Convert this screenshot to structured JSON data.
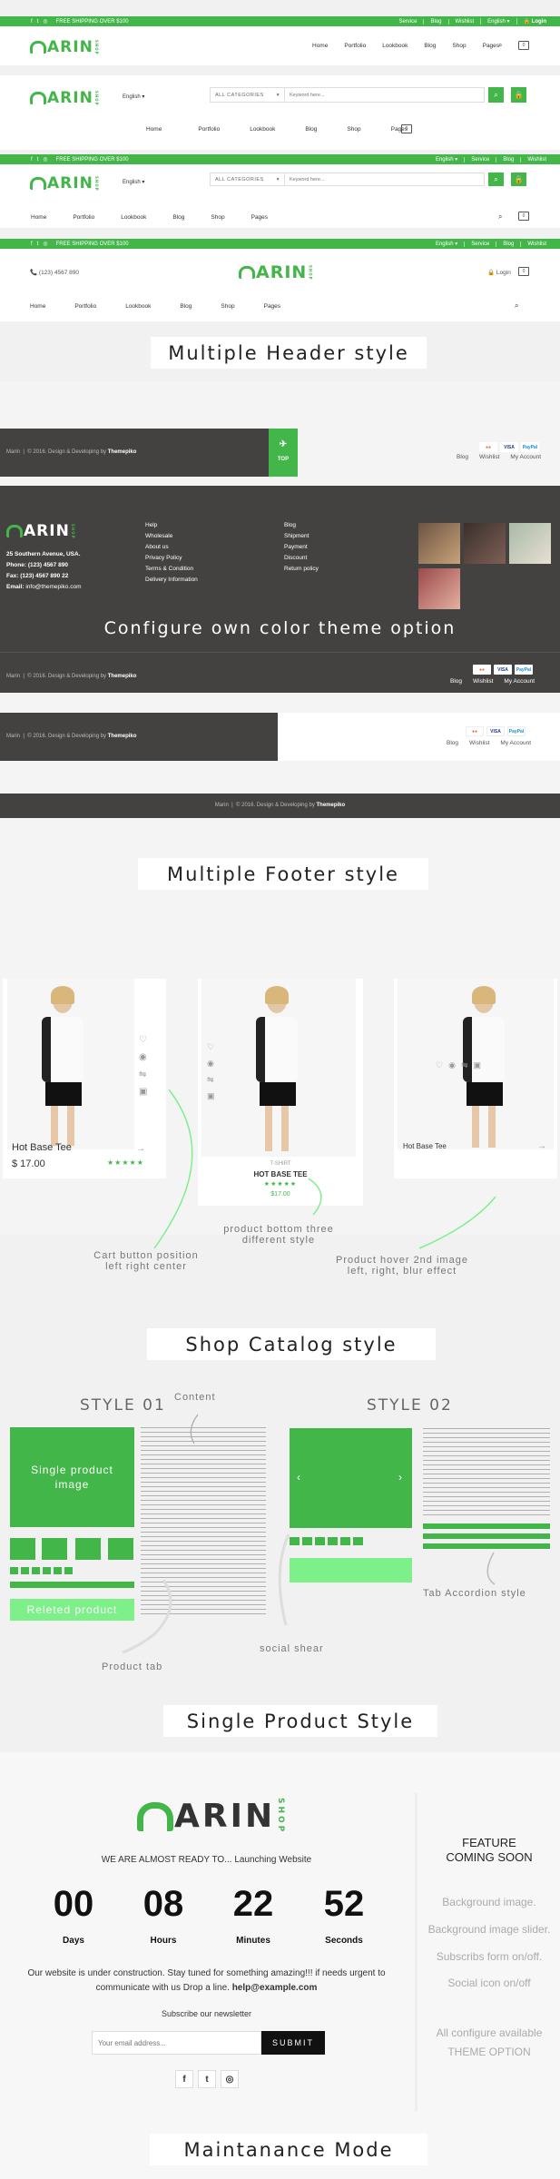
{
  "header1": {
    "shipping": "FREE SHIPPING OVER $100",
    "top_links": [
      "Service",
      "Blog",
      "Wishlist",
      "English ▾",
      "Login"
    ],
    "nav": [
      "Home",
      "Portfolio",
      "Lookbook",
      "Blog",
      "Shop",
      "Pages"
    ]
  },
  "header2": {
    "language": "English ▾",
    "category": "ALL CATEGORIES",
    "search_placeholder": "Keyword here...",
    "nav": [
      "Home",
      "Portfolio",
      "Lookbook",
      "Blog",
      "Shop",
      "Pages"
    ]
  },
  "header3": {
    "shipping": "FREE SHIPPING OVER $100",
    "top_links": [
      "English ▾",
      "Service",
      "Blog",
      "Wishlist"
    ],
    "language": "English ▾",
    "category": "ALL CATEGORIES",
    "search_placeholder": "Keyword here...",
    "nav": [
      "Home",
      "Portfolio",
      "Lookbook",
      "Blog",
      "Shop",
      "Pages"
    ]
  },
  "header4": {
    "shipping": "FREE SHIPPING OVER $100",
    "top_links": [
      "English ▾",
      "Service",
      "Blog",
      "Wishlist"
    ],
    "phone": "(123) 4567 890",
    "login": "Login",
    "nav": [
      "Home",
      "Portfolio",
      "Lookbook",
      "Blog",
      "Shop",
      "Pages"
    ]
  },
  "logo": {
    "m": "M",
    "rest": "ARIN",
    "shop": "SHOP",
    "accent": "#43b649"
  },
  "titles": {
    "header": "Multiple Header style",
    "footer": "Multiple Footer style",
    "catalog": "Shop Catalog style",
    "single": "Single Product Style",
    "maintenance": "Maintanance Mode"
  },
  "footer1": {
    "copyright_brand": "Marin",
    "copyright": "© 2016. Design & Developing by",
    "author": "Themepiko",
    "top": "TOP",
    "links": [
      "Blog",
      "Wishlist",
      "My Account"
    ],
    "payments": [
      "MC",
      "VISA",
      "PayPal"
    ]
  },
  "footer2": {
    "address": "25 Southern Avenue, USA.",
    "phone_label": "Phone:",
    "phone": "(123) 4567 890",
    "fax_label": "Fax:",
    "fax": "(123) 4567 890 22",
    "email_label": "Email:",
    "email": "info@themepiko.com",
    "col1": [
      "Help",
      "Wholesale",
      "About us",
      "Privacy Policy",
      "Terms & Condition",
      "Delivery Information"
    ],
    "col2": [
      "Blog",
      "Shipment",
      "Payment",
      "Discount",
      "Return policy"
    ],
    "theme_text": "Configure own color theme option",
    "copyright_brand": "Marin",
    "copyright": "© 2016. Design & Developing by",
    "author": "Themepiko",
    "links": [
      "Blog",
      "Wishlist",
      "My Account"
    ]
  },
  "footer3": {
    "copyright_brand": "Marin",
    "copyright": "© 2016. Design & Developing by",
    "author": "Themepiko",
    "links": [
      "Blog",
      "Wishlist",
      "My Account"
    ]
  },
  "footer4": {
    "copyright_brand": "Marin",
    "copyright": "© 2016. Design & Developing by",
    "author": "Themepiko"
  },
  "catalog": {
    "p1": {
      "name": "Hot Base Tee",
      "price": "$ 17.00",
      "stars": "★★★★★"
    },
    "p2": {
      "category": "T-SHIRT",
      "name": "HOT BASE TEE",
      "price": "$17.00",
      "stars": "★★★★★"
    },
    "p3": {
      "name": "Hot Base Tee"
    },
    "notes": [
      "Cart button position",
      "left right center",
      "product bottom three",
      "different style",
      "Product hover 2nd image",
      "left, right, blur effect"
    ]
  },
  "single": {
    "style1": "STYLE 01",
    "style2": "STYLE 02",
    "content": "Content",
    "single_image": "Single product image",
    "related": "Releted product",
    "product_tab": "Product tab",
    "social": "social shear",
    "accordion": "Tab Accordion style"
  },
  "maintenance": {
    "almost": "WE ARE ALMOST READY TO... Launching Website",
    "counts": [
      {
        "num": "00",
        "label": "Days"
      },
      {
        "num": "08",
        "label": "Hours"
      },
      {
        "num": "22",
        "label": "Minutes"
      },
      {
        "num": "52",
        "label": "Seconds"
      }
    ],
    "message1": "Our website is under construction. Stay tuned for something amazing!!! if needs urgent to",
    "message2": "communicate with us Drop a line.",
    "email": "help@example.com",
    "subscribe": "Subscribe our newsletter",
    "email_placeholder": "Your email address...",
    "submit": "SUBMIT",
    "feature1": "FEATURE",
    "feature2": "COMING SOON",
    "features": [
      "Background image.",
      "Background image slider.",
      "Subscribs form on/off.",
      "Social icon on/off"
    ],
    "all_config": "All configure available",
    "theme_option": "THEME OPTION"
  }
}
